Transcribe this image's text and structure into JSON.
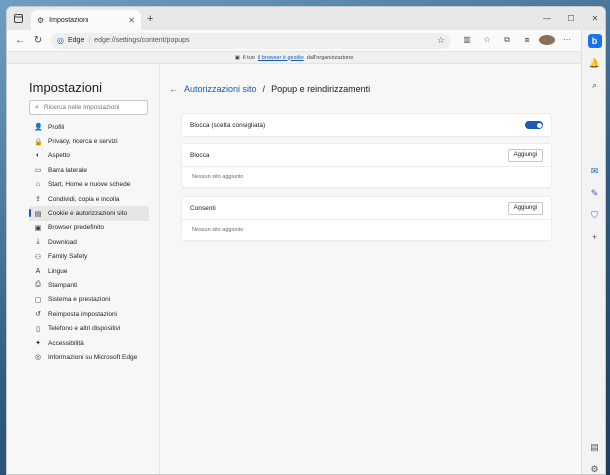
{
  "browser": {
    "tab_title": "Impostazioni",
    "address_prefix": "Edge",
    "address_url": "edge://settings/content/popups",
    "banner_prefix": "Il tuo",
    "banner_link": "il browser è gestito",
    "banner_suffix": "dall'organizzazione"
  },
  "sidebar": {
    "title": "Impostazioni",
    "search_placeholder": "Ricerca nelle impostazioni",
    "items": [
      {
        "label": "Profili",
        "icon": "profile-icon",
        "glyph": "👤"
      },
      {
        "label": "Privacy, ricerca e servizi",
        "icon": "lock-icon",
        "glyph": "🔒"
      },
      {
        "label": "Aspetto",
        "icon": "palette-icon",
        "glyph": "◐"
      },
      {
        "label": "Barra laterale",
        "icon": "sidebar-icon",
        "glyph": "▭"
      },
      {
        "label": "Start, Home e nuove schede",
        "icon": "home-icon",
        "glyph": "⌂"
      },
      {
        "label": "Condividi, copia e incolla",
        "icon": "share-icon",
        "glyph": "⇪"
      },
      {
        "label": "Cookie e autorizzazioni sito",
        "icon": "cookie-permissions-icon",
        "glyph": "▤",
        "active": true
      },
      {
        "label": "Browser predefinito",
        "icon": "browser-icon",
        "glyph": "▣"
      },
      {
        "label": "Download",
        "icon": "download-icon",
        "glyph": "⤓"
      },
      {
        "label": "Family Safety",
        "icon": "family-icon",
        "glyph": "⚇"
      },
      {
        "label": "Lingue",
        "icon": "language-icon",
        "glyph": "A"
      },
      {
        "label": "Stampanti",
        "icon": "printer-icon",
        "glyph": "⎙"
      },
      {
        "label": "Sistema e prestazioni",
        "icon": "system-icon",
        "glyph": "▢"
      },
      {
        "label": "Reimposta impostazioni",
        "icon": "reset-icon",
        "glyph": "↺"
      },
      {
        "label": "Telefono e altri dispositivi",
        "icon": "phone-icon",
        "glyph": "▯"
      },
      {
        "label": "Accessibilità",
        "icon": "accessibility-icon",
        "glyph": "✦"
      },
      {
        "label": "Informazioni su Microsoft Edge",
        "icon": "edge-logo-icon",
        "glyph": "◎"
      }
    ]
  },
  "main": {
    "breadcrumb_parent": "Autorizzazioni sito",
    "breadcrumb_sep": "/",
    "breadcrumb_current": "Popup e reindirizzamenti",
    "block_recommended_label": "Blocca (scelta consigliata)",
    "block_recommended_on": true,
    "block_section_title": "Blocca",
    "block_add_label": "Aggiungi",
    "block_empty": "Nessun sito aggiunto",
    "allow_section_title": "Consenti",
    "allow_add_label": "Aggiungi",
    "allow_empty": "Nessun sito aggiunto"
  },
  "colors": {
    "accent": "#1a5bb5"
  }
}
